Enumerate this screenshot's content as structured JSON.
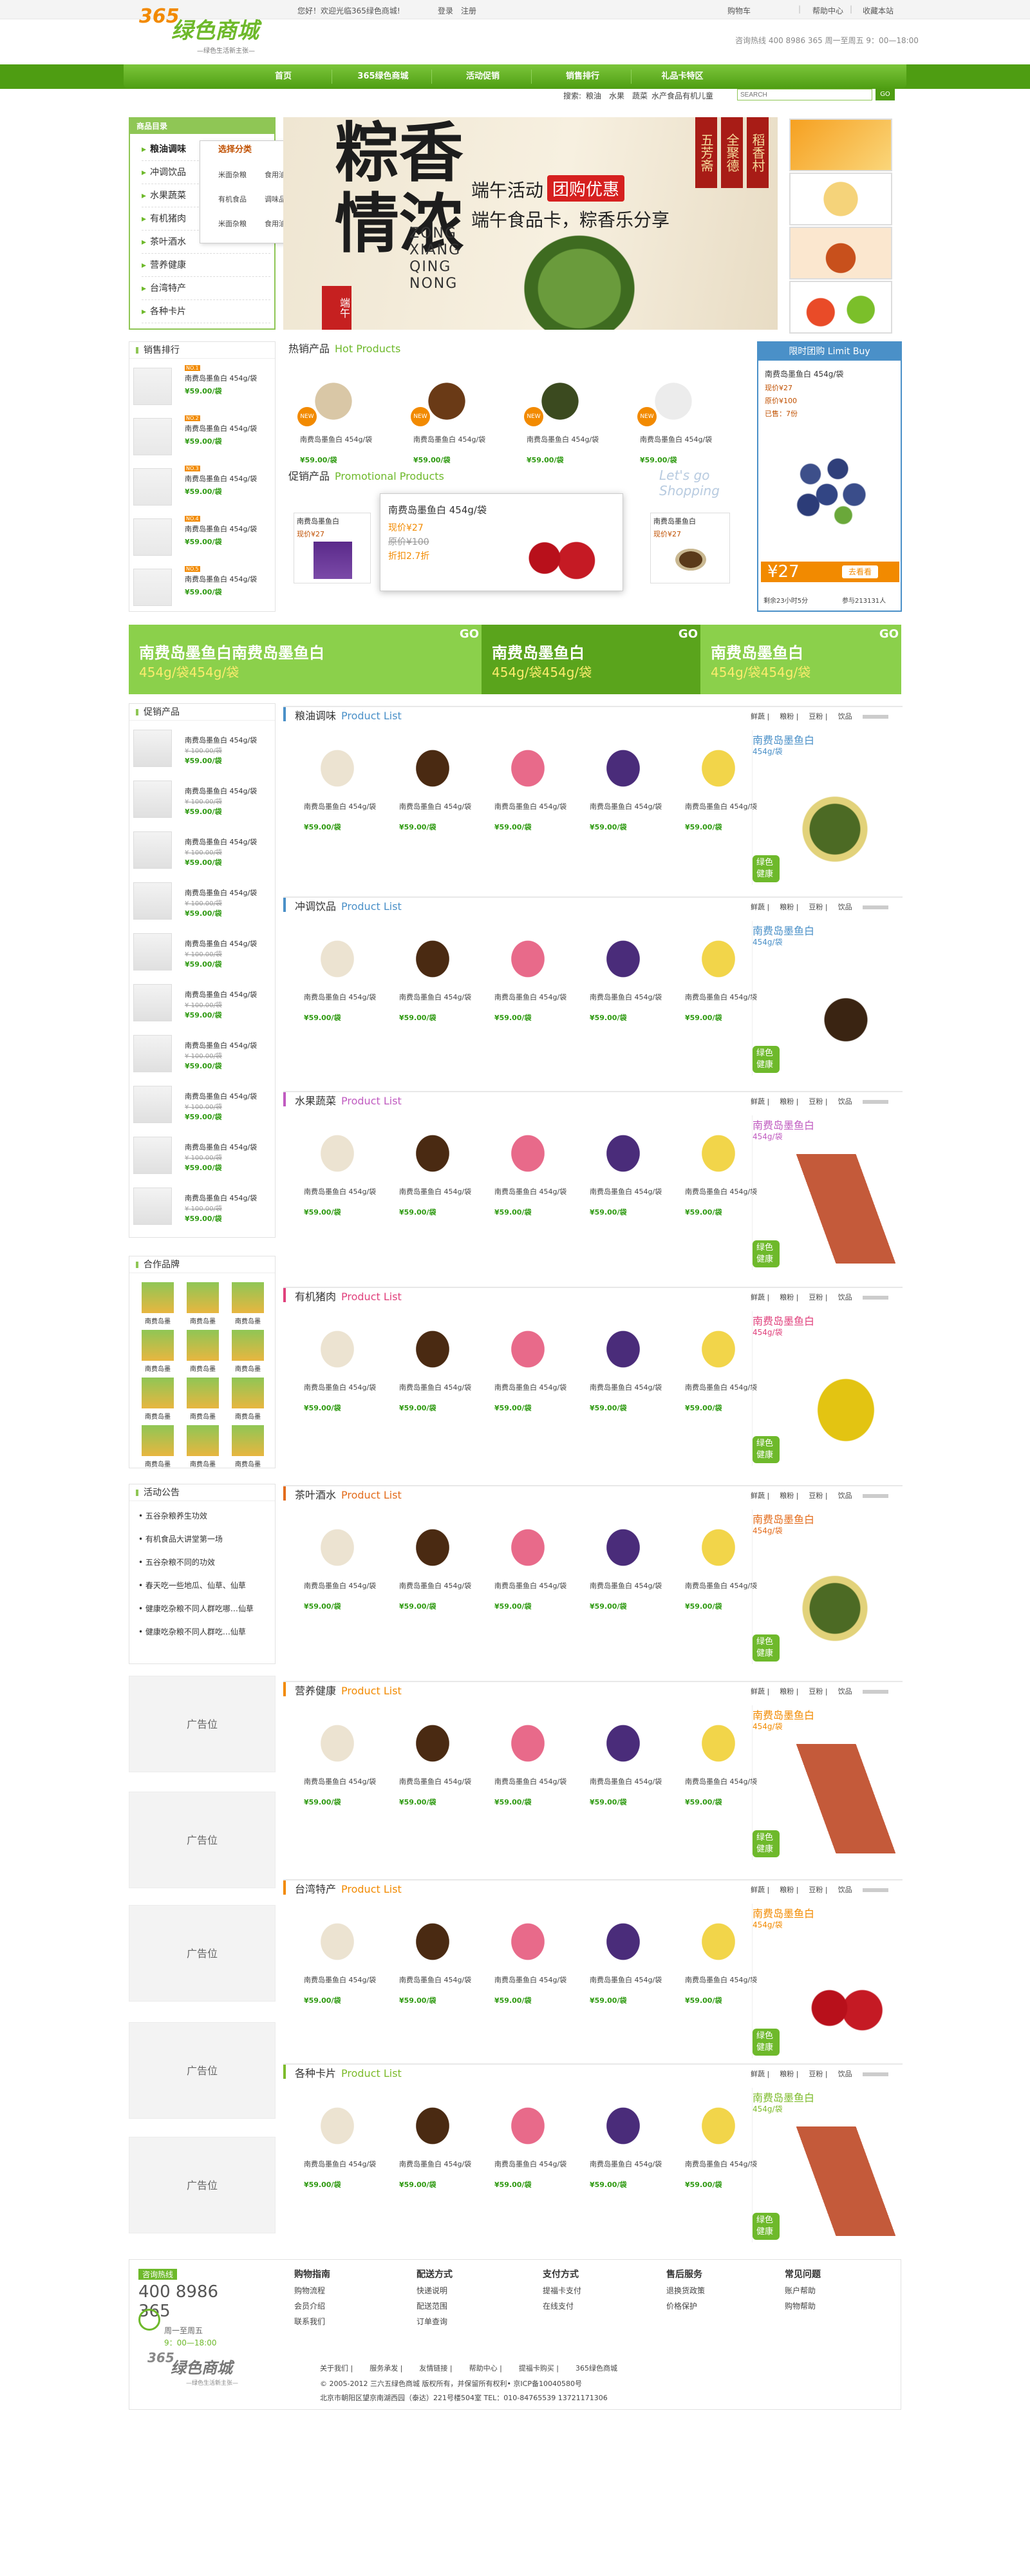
{
  "topbar": {
    "welcome": "您好！欢迎光临365绿色商城!",
    "login": "登录",
    "register": "注册",
    "cart": "购物车",
    "help": "帮助中心",
    "bookmark": "收藏本站"
  },
  "logo": {
    "num": "365",
    "title": "绿色商城",
    "slogan": "—绿色生活新主张—"
  },
  "hotline_top": "咨询热线 400 8986 365   周一至周五 9：00—18:00",
  "nav": [
    "首页",
    "365绿色商城",
    "活动促销",
    "销售排行",
    "礼品卡特区"
  ],
  "search": {
    "label": "搜索:",
    "keywords": [
      "粮油",
      "水果",
      "蔬菜",
      "水产食品",
      "有机儿童"
    ],
    "placeholder": "SEARCH",
    "go": "GO"
  },
  "category": {
    "title": "商品目录",
    "items": [
      "粮油调味",
      "冲调饮品",
      "水果蔬菜",
      "有机猪肉",
      "茶叶酒水",
      "营养健康",
      "台湾特产",
      "各种卡片"
    ],
    "flyout_title": "选择分类",
    "flyout_items": [
      "米面杂粮",
      "食用油",
      "南北干货",
      "有机食品",
      "调味品酱油",
      "南北干货",
      "米面杂粮",
      "食用油",
      "南北干货"
    ]
  },
  "banner": {
    "big_chars": "粽香情浓",
    "pinyin": "ZONG XIANG QING NONG",
    "activity": "端午活动",
    "tag": "团购优惠",
    "sub": "端午食品卡，粽香乐分享",
    "labels": [
      "五芳斋",
      "全聚德",
      "稻香村"
    ],
    "duanwu": "端午"
  },
  "rank": {
    "title": "销售排行",
    "items": [
      {
        "badge": "NO.1",
        "name": "南费岛墨鱼白 454g/袋",
        "price": "¥59.00/袋"
      },
      {
        "badge": "NO.2",
        "name": "南费岛墨鱼白 454g/袋",
        "price": "¥59.00/袋"
      },
      {
        "badge": "NO.3",
        "name": "南费岛墨鱼白 454g/袋",
        "price": "¥59.00/袋"
      },
      {
        "badge": "NO.4",
        "name": "南费岛墨鱼白 454g/袋",
        "price": "¥59.00/袋"
      },
      {
        "badge": "NO.5",
        "name": "南费岛墨鱼白 454g/袋",
        "price": "¥59.00/袋"
      }
    ]
  },
  "hot": {
    "title": "热销产品",
    "title_en": "Hot Products",
    "items": [
      {
        "name": "南费岛墨鱼白 454g/袋",
        "price": "¥59.00/袋"
      },
      {
        "name": "南费岛墨鱼白 454g/袋",
        "price": "¥59.00/袋"
      },
      {
        "name": "南费岛墨鱼白 454g/袋",
        "price": "¥59.00/袋"
      },
      {
        "name": "南费岛墨鱼白 454g/袋",
        "price": "¥59.00/袋"
      }
    ]
  },
  "promo": {
    "title": "促销产品",
    "title_en": "Promotional Products",
    "watermark": "Let's go Shopping",
    "small_name": "南费岛墨鱼白",
    "small_price": "现价¥27",
    "popup": {
      "name": "南费岛墨鱼白 454g/袋",
      "now": "现价¥27",
      "was": "原价¥100",
      "discount": "折扣2.7折"
    }
  },
  "limit": {
    "title": "限时团购",
    "title_en": "Limit Buy",
    "name": "南费岛墨鱼白 454g/袋",
    "now_label": "现价¥27",
    "was_label": "原价¥100",
    "sold": "已售：7份",
    "price": "¥27",
    "go": "去看看",
    "remain": "剩余23小时5分",
    "count": "参与213131人"
  },
  "strip": [
    {
      "t1": "南费岛墨鱼白南费岛墨鱼白",
      "t2": "454g/袋454g/袋",
      "go": "GO"
    },
    {
      "t1": "南费岛墨鱼白",
      "t2": "454g/袋454g/袋",
      "go": "GO"
    },
    {
      "t1": "南费岛墨鱼白",
      "t2": "454g/袋454g/袋",
      "go": "GO"
    }
  ],
  "promo_left": {
    "title": "促销产品",
    "name": "南费岛墨鱼白 454g/袋",
    "old": "¥ 100.00/袋",
    "price": "¥59.00/袋",
    "count": 10
  },
  "partner": {
    "title": "合作品牌",
    "label": "南费岛墨"
  },
  "notice": {
    "title": "活动公告",
    "items": [
      "五谷杂粮养生功效",
      "有机食品大讲堂第一场",
      "五谷杂粮不同的功效",
      "春天吃一些地瓜、仙草、仙草",
      "健康吃杂粮不同人群吃哪…仙草",
      "健康吃杂粮不同人群吃…仙草"
    ]
  },
  "ad_label": "广告位",
  "sections": [
    {
      "title": "粮油调味",
      "color": "#4a90c8"
    },
    {
      "title": "冲调饮品",
      "color": "#4a90c8"
    },
    {
      "title": "水果蔬菜",
      "color": "#c05bc0"
    },
    {
      "title": "有机猪肉",
      "color": "#e0417c"
    },
    {
      "title": "茶叶酒水",
      "color": "#e36c1c"
    },
    {
      "title": "营养健康",
      "color": "#f28a00"
    },
    {
      "title": "台湾特产",
      "color": "#f28a00"
    },
    {
      "title": "各种卡片",
      "color": "#7dbb2b"
    }
  ],
  "section_en": "Product List",
  "section_tabs": [
    "鲜蔬",
    "粮粉",
    "豆粉",
    "饮品"
  ],
  "section_product": {
    "name": "南费岛墨鱼白 454g/袋",
    "price": "¥59.00/袋"
  },
  "section_side": {
    "title": "南费岛墨鱼白",
    "weight": "454g/袋",
    "leaf": "绿色健康"
  },
  "footer": {
    "hot_label": "咨询热线",
    "hot_number": "400 8986 365",
    "hot_time_a": "周一至周五",
    "hot_time_b": "9：00—18:00",
    "groups": [
      {
        "title": "购物指南",
        "links": [
          "购物流程",
          "会员介绍",
          "联系我们"
        ]
      },
      {
        "title": "配送方式",
        "links": [
          "快递说明",
          "配送范围",
          "订单查询"
        ]
      },
      {
        "title": "支付方式",
        "links": [
          "提福卡支付",
          "在线支付"
        ]
      },
      {
        "title": "售后服务",
        "links": [
          "退换货政策",
          "价格保护"
        ]
      },
      {
        "title": "常见问题",
        "links": [
          "账户帮助",
          "购物帮助"
        ]
      }
    ],
    "links": [
      "关于我们",
      "服务承发",
      "友情链接",
      "帮助中心",
      "提福卡购买",
      "365绿色商城"
    ],
    "copy": "© 2005-2012 三六五绿色商城 版权所有，并保留所有权利• 京ICP备10040580号",
    "addr": "北京市朝阳区望京南湖西园（泰达）221号楼504室   TEL：010-84765539 13721171306"
  }
}
